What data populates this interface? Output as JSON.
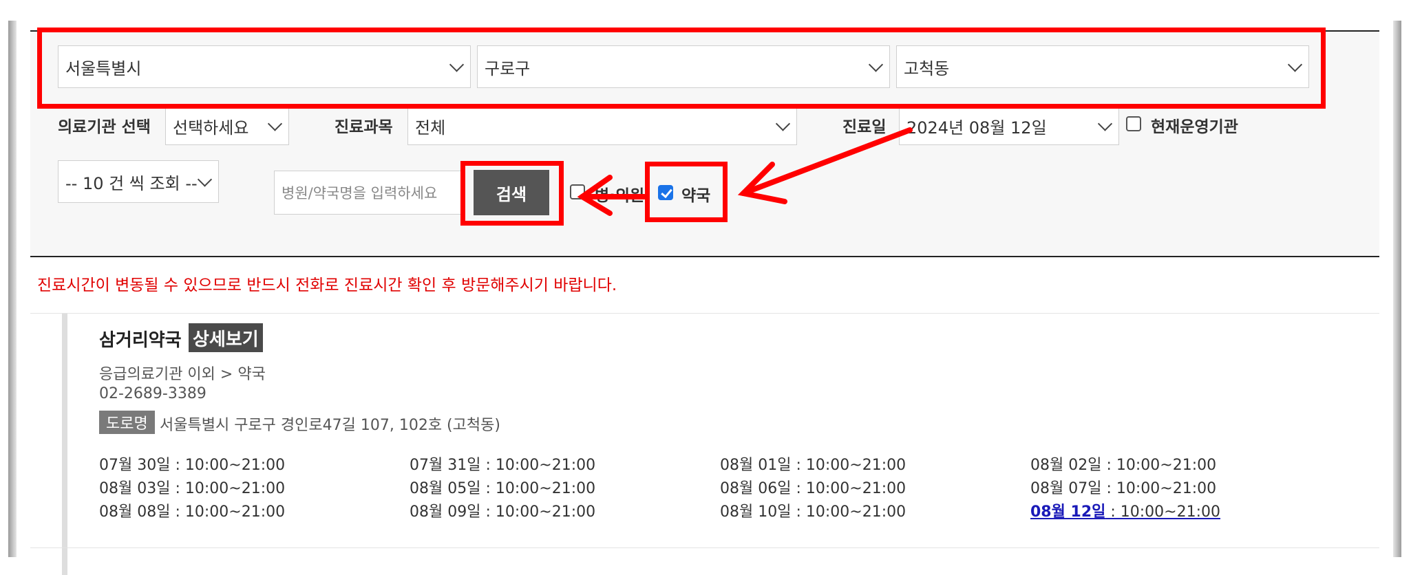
{
  "region": {
    "city": "서울특별시",
    "district": "구로구",
    "dong": "고척동"
  },
  "filters": {
    "institution_label": "의료기관 선택",
    "institution_value": "선택하세요",
    "department_label": "진료과목",
    "department_value": "전체",
    "date_label": "진료일",
    "date_value": "2024년 08월 12일",
    "open_now_label": "현재운영기관",
    "page_size_value": "-- 10 건 씩 조회 --",
    "search_placeholder": "병원/약국명을 입력하세요",
    "search_button": "검색",
    "hospital_label": "병·의원",
    "pharmacy_label": "약국",
    "pharmacy_checked": true,
    "hospital_checked": false,
    "open_now_checked": false
  },
  "notice": "진료시간이 변동될 수 있으므로 반드시 전화로 진료시간 확인 후 방문해주시기 바랍니다.",
  "result": {
    "name": "삼거리약국",
    "detail_button": "상세보기",
    "category": "응급의료기관 이외 > 약국",
    "phone": "02-2689-3389",
    "road_badge": "도로명",
    "address": "서울특별시 구로구 경인로47길 107, 102호 (고척동)",
    "hours": [
      {
        "date": "07월 30일",
        "time": " : 10:00~21:00"
      },
      {
        "date": "07월 31일",
        "time": " : 10:00~21:00"
      },
      {
        "date": "08월 01일",
        "time": " : 10:00~21:00"
      },
      {
        "date": "08월 02일",
        "time": " : 10:00~21:00"
      },
      {
        "date": "08월 03일",
        "time": " : 10:00~21:00"
      },
      {
        "date": "08월 05일",
        "time": " : 10:00~21:00"
      },
      {
        "date": "08월 06일",
        "time": " : 10:00~21:00"
      },
      {
        "date": "08월 07일",
        "time": " : 10:00~21:00"
      },
      {
        "date": "08월 08일",
        "time": " : 10:00~21:00"
      },
      {
        "date": "08월 09일",
        "time": " : 10:00~21:00"
      },
      {
        "date": "08월 10일",
        "time": " : 10:00~21:00"
      },
      {
        "date": "08월 12일",
        "time": " : 10:00~21:00"
      }
    ]
  },
  "colors": {
    "highlight": "#ff0000",
    "accent": "#1a73e8",
    "notice": "#e00000",
    "button": "#555555"
  }
}
